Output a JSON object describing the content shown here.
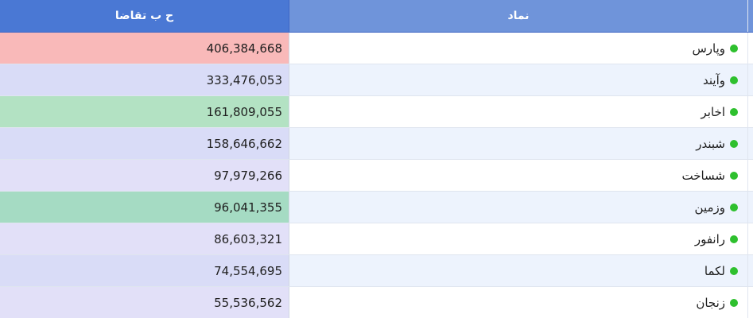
{
  "header": {
    "demand_label": "ح ب تقاضا",
    "symbol_label": "نماد"
  },
  "colors": {
    "status_dot": "#2ec02e",
    "header_dark": "#4a78d4",
    "header_light": "#6f94da"
  },
  "rows": [
    {
      "symbol": "وپارس",
      "demand": "406,384,668",
      "bg": "#f9b9b9"
    },
    {
      "symbol": "وآیند",
      "demand": "333,476,053",
      "bg": "#d9dcf7"
    },
    {
      "symbol": "اخابر",
      "demand": "161,809,055",
      "bg": "#b3e2c3"
    },
    {
      "symbol": "شبندر",
      "demand": "158,646,662",
      "bg": "#d9dcf7"
    },
    {
      "symbol": "شساخت",
      "demand": "97,979,266",
      "bg": "#e2e0f8"
    },
    {
      "symbol": "وزمین",
      "demand": "96,041,355",
      "bg": "#a5dbc3"
    },
    {
      "symbol": "رانفور",
      "demand": "86,603,321",
      "bg": "#e2e0f8"
    },
    {
      "symbol": "لکما",
      "demand": "74,554,695",
      "bg": "#d9dcf7"
    },
    {
      "symbol": "زنجان",
      "demand": "55,536,562",
      "bg": "#e2e0f8"
    }
  ],
  "partial_row_bg": "#a5dbc3"
}
